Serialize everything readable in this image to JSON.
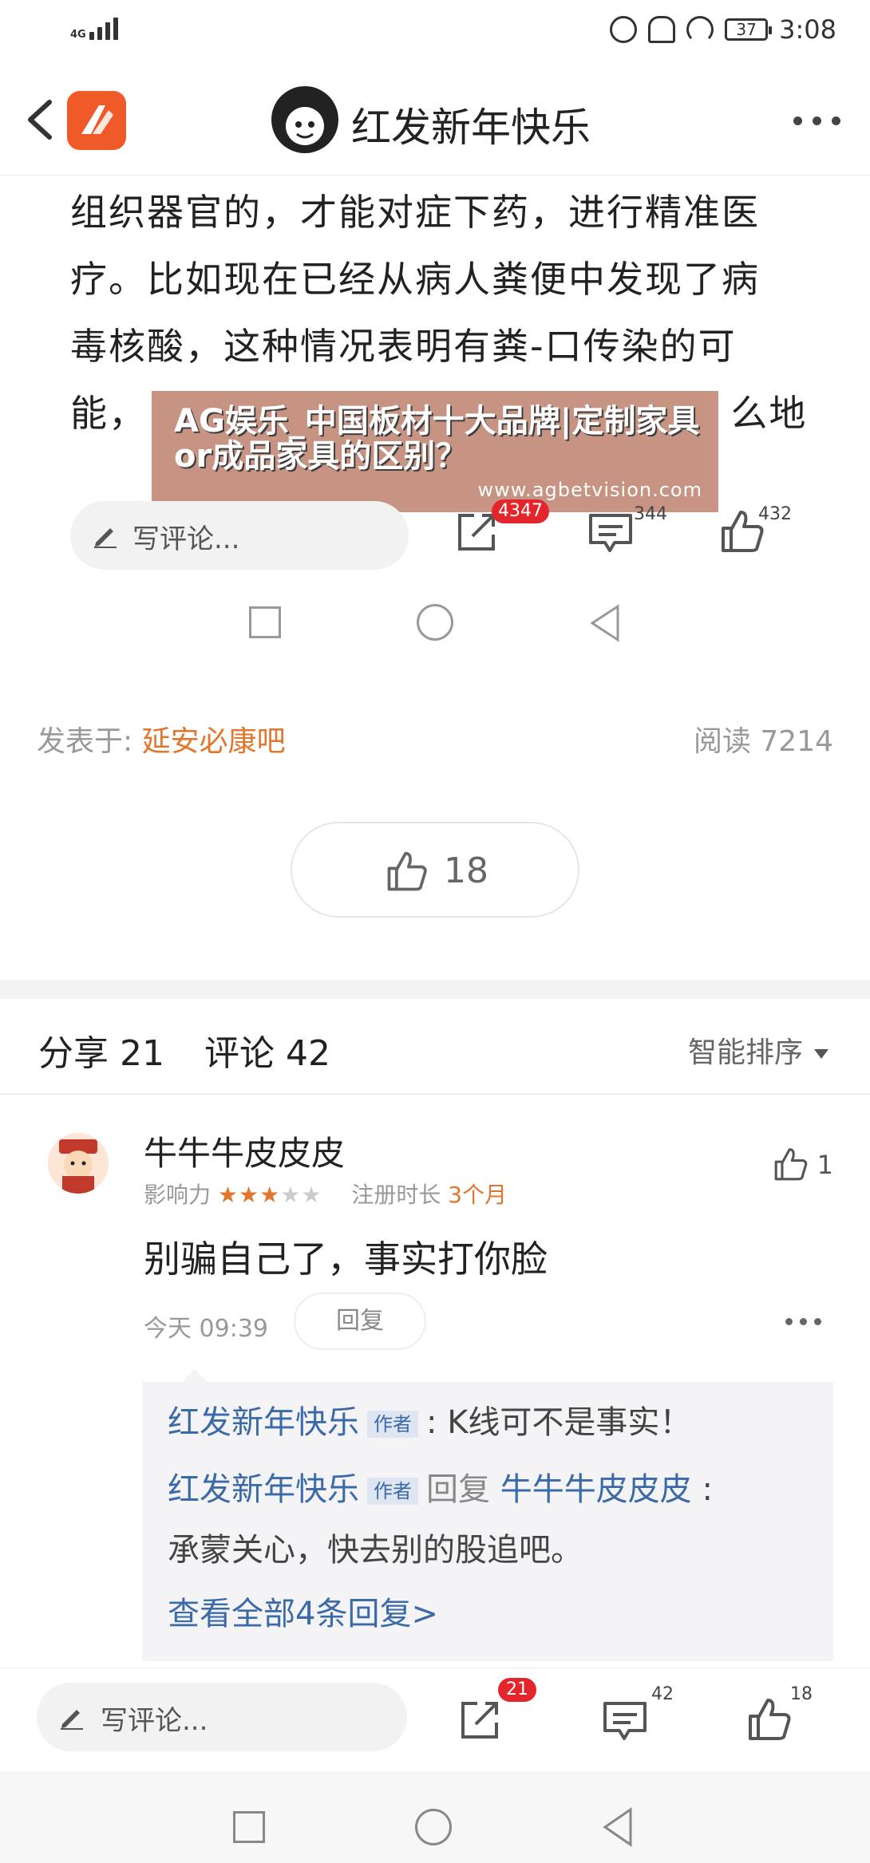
{
  "status_bar": {
    "network": "4G",
    "battery": "37",
    "time": "3:08"
  },
  "header": {
    "title": "红发新年快乐"
  },
  "article": {
    "lines": [
      "组织器官的，才能对症下药，进行精准医",
      "疗。比如现在已经从病人粪便中发现了病",
      "毒核酸，这种情况表明有粪-口传染的可",
      "能，                                            么地"
    ]
  },
  "ad": {
    "title": "AG娱乐_中国板材十大品牌|定制家具or成品家具的区别？",
    "url": "www.agbetvision.com"
  },
  "inner_toolbar": {
    "placeholder": "写评论...",
    "share_count": "4347",
    "comment_count": "344",
    "like_count": "432"
  },
  "post_meta": {
    "posted_in_label": "发表于:",
    "forum": "延安必康吧",
    "read_label": "阅读 7214"
  },
  "like_button": {
    "count": "18"
  },
  "tabs": {
    "share": "分享 21",
    "comment": "评论 42",
    "sort": "智能排序"
  },
  "comment": {
    "author": "牛牛牛皮皮皮",
    "influence_label": "影响力",
    "stars": "★★★★★",
    "star_rating": 3,
    "reg_label": "注册时长",
    "reg_value": "3个月",
    "like_count": "1",
    "body": "别骗自己了，事实打你脸",
    "time": "今天 09:39",
    "reply_label": "回复",
    "replies": [
      {
        "user": "红发新年快乐",
        "tag": "作者",
        "text": ": K线可不是事实！"
      },
      {
        "user": "红发新年快乐",
        "tag": "作者",
        "reply_word": "回复",
        "target": "牛牛牛皮皮皮",
        "sep": ":",
        "text": "承蒙关心，快去别的股追吧。"
      }
    ],
    "view_all": "查看全部4条回复>"
  },
  "bottom_toolbar": {
    "placeholder": "写评论...",
    "share_count": "21",
    "comment_count": "42",
    "like_count": "18"
  },
  "colors": {
    "accent_orange": "#e2762c",
    "link_blue": "#3b6aa8",
    "badge_red": "#e2262c"
  }
}
